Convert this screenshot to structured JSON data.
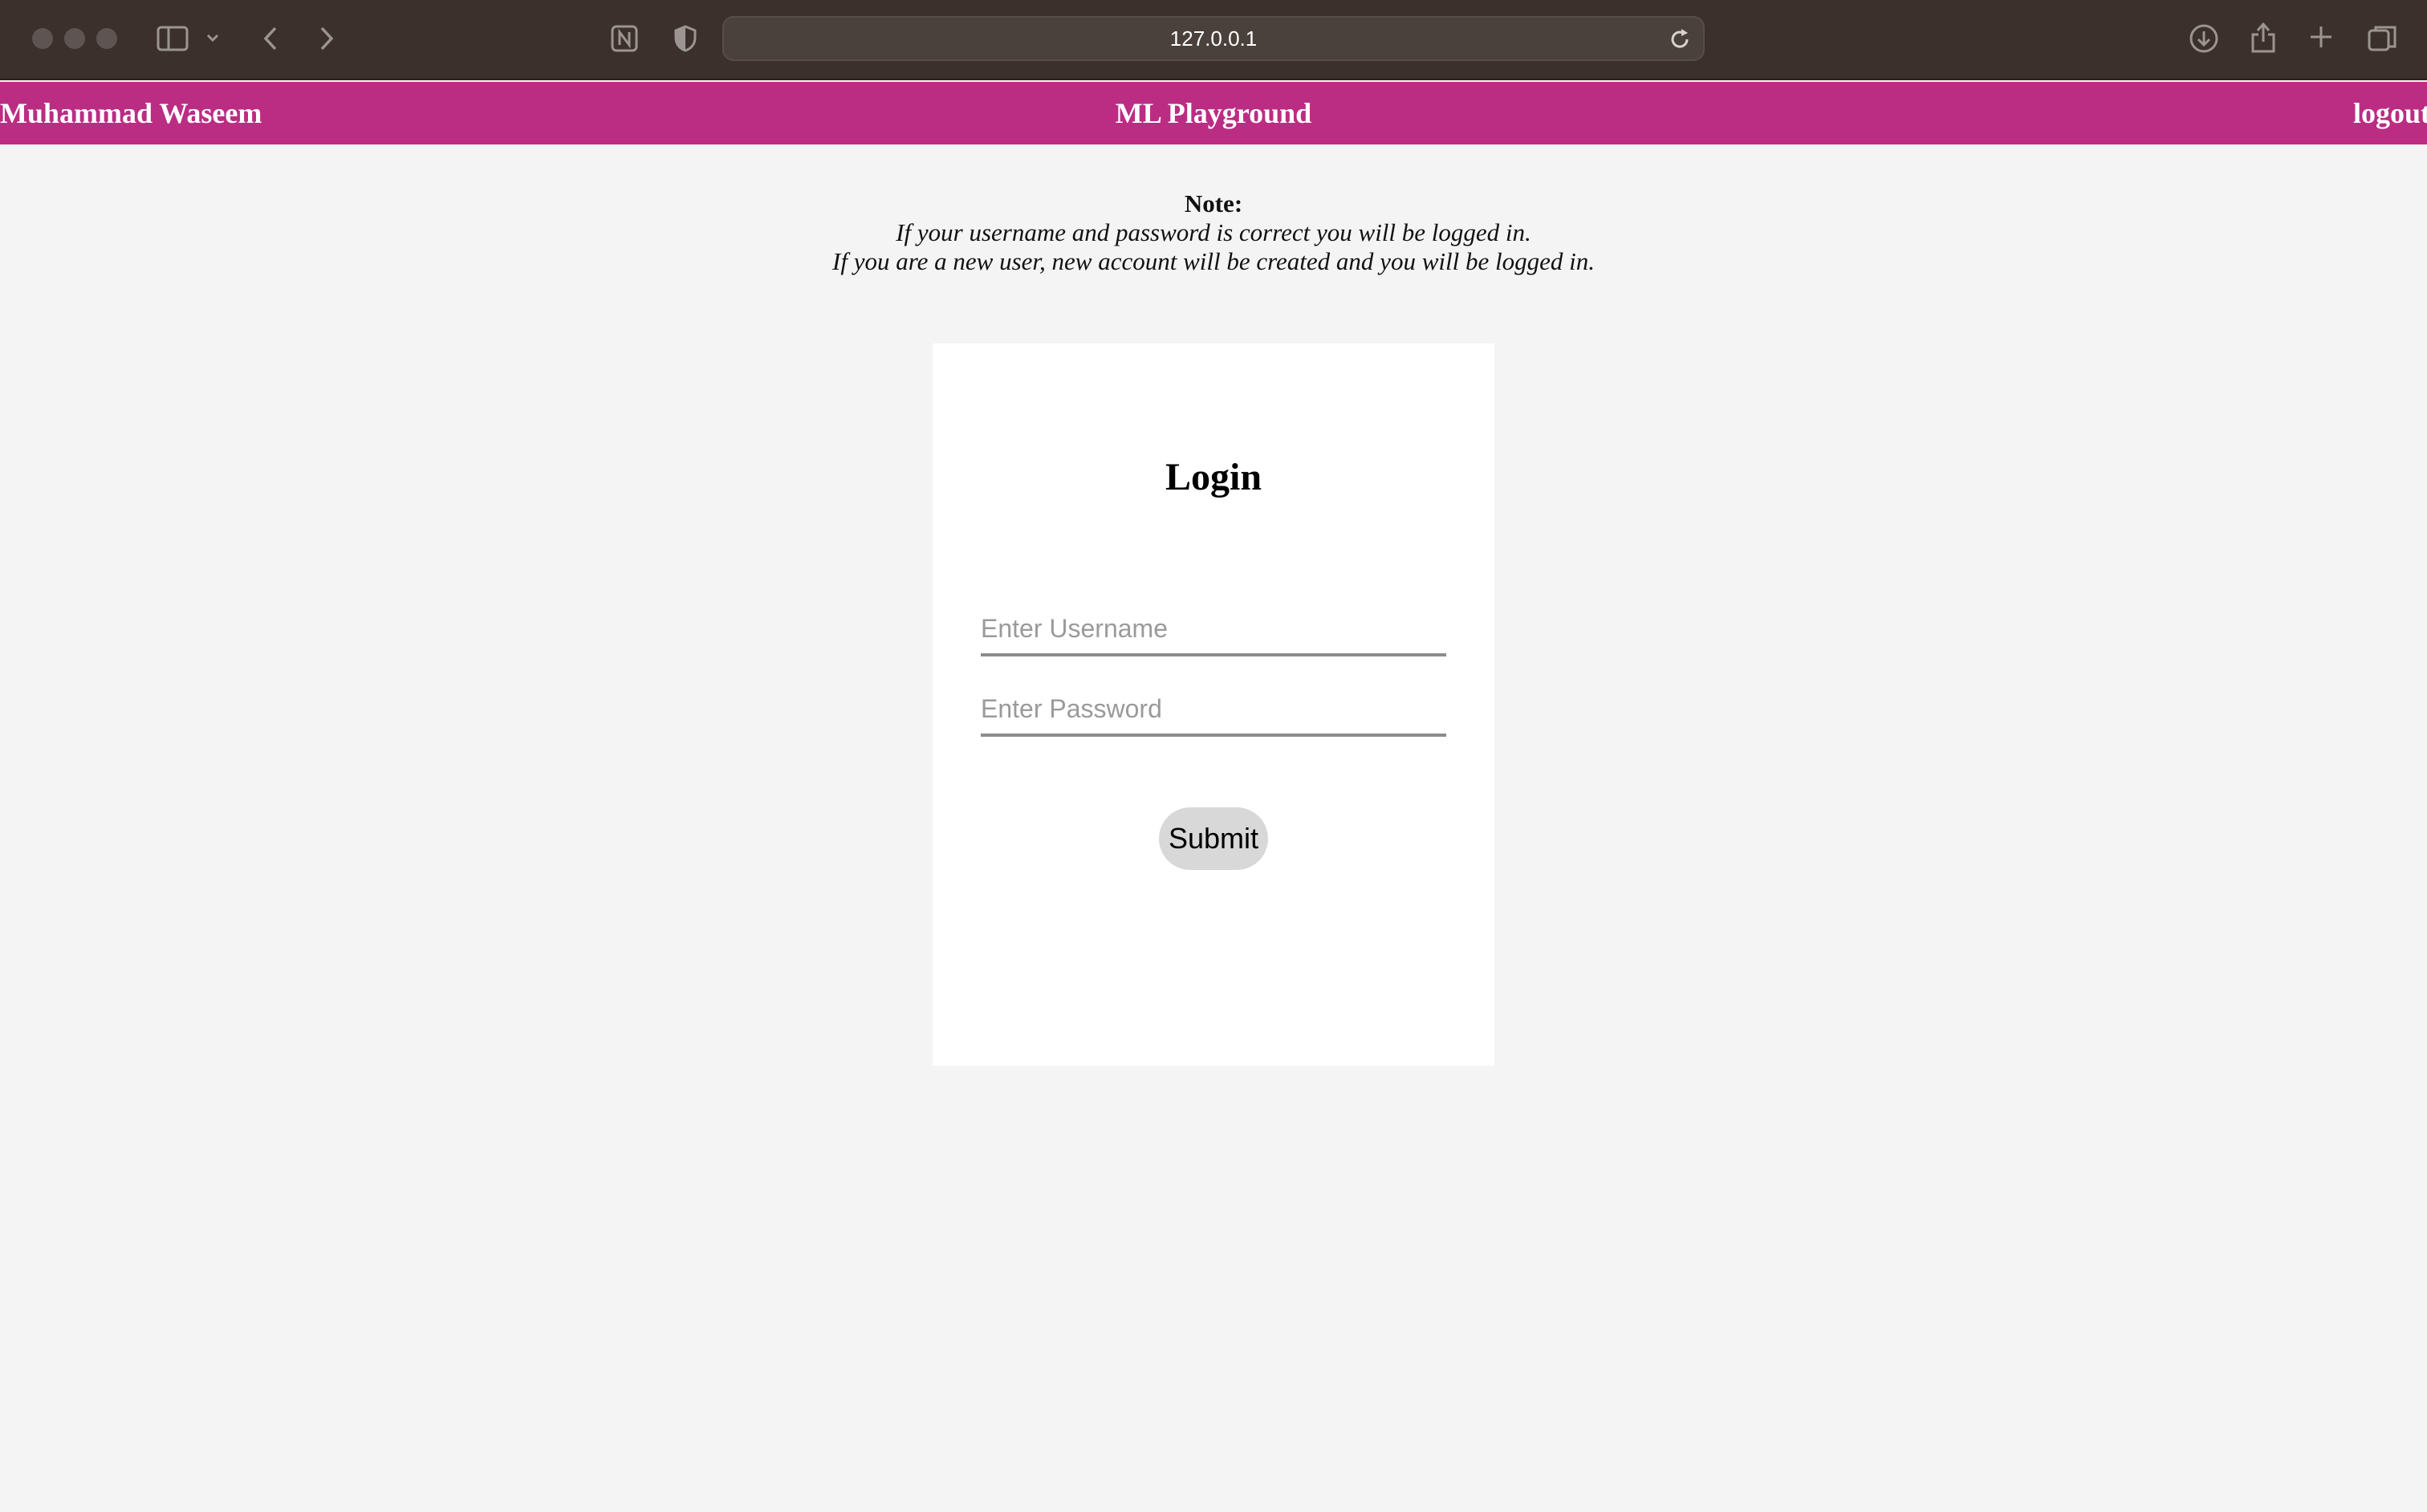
{
  "browser": {
    "address": "127.0.0.1"
  },
  "header": {
    "user_name": "Muhammad Waseem",
    "title": "ML Playground",
    "logout_label": "logout",
    "color": "#bb2d83"
  },
  "note": {
    "title": "Note:",
    "line1": "If your username and password is correct you will be logged in.",
    "line2": "If you are a new user, new account will be created and you will be logged in."
  },
  "login": {
    "heading": "Login",
    "username_placeholder": "Enter Username",
    "username_value": "",
    "password_placeholder": "Enter Password",
    "password_value": "",
    "submit_label": "Submit"
  }
}
